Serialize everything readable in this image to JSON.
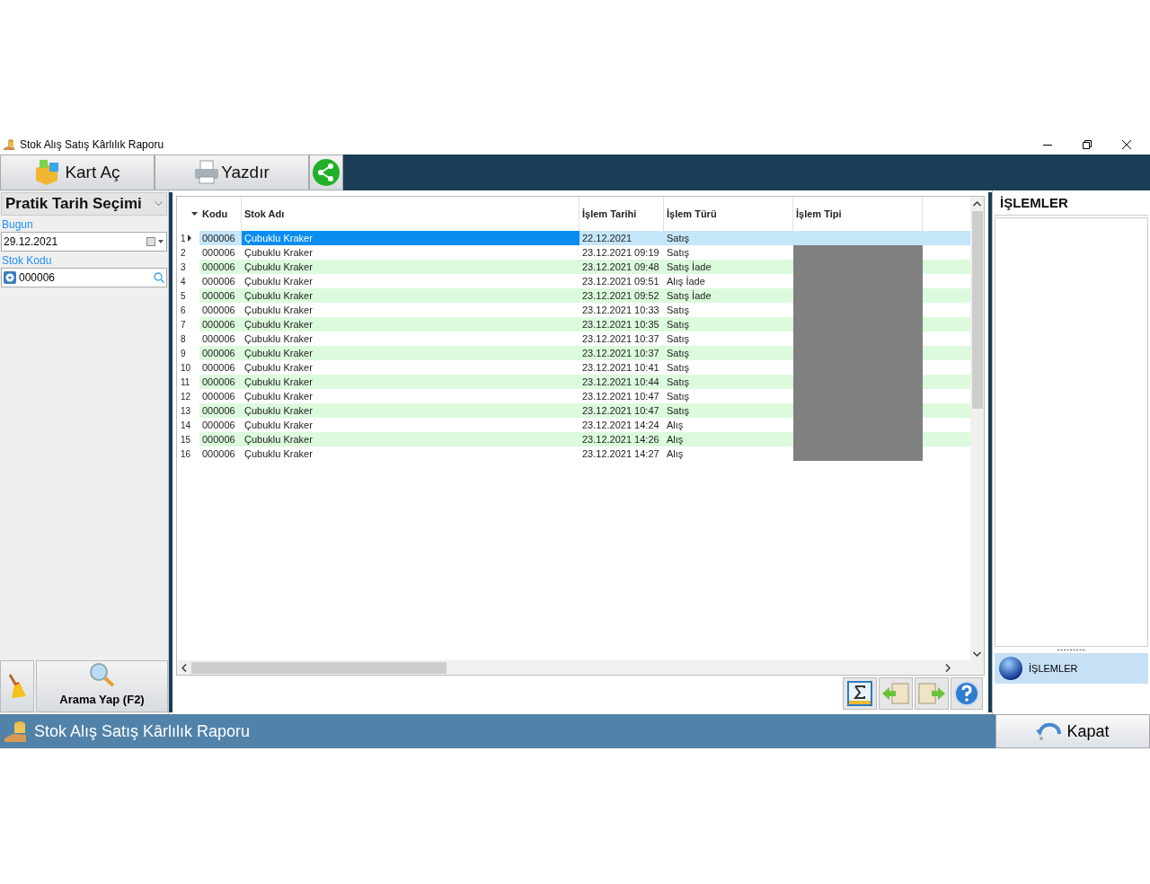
{
  "window": {
    "title": "Stok Alış Satış Kârlılık Raporu"
  },
  "toolbar": {
    "buttons": [
      {
        "label": "Kart Aç",
        "kind": "cube"
      },
      {
        "label": "Yazdır",
        "kind": "printer"
      },
      {
        "kind": "share"
      }
    ]
  },
  "filter_panel": {
    "dropdown": "Pratik Tarih Seçimi",
    "date_label": "Bugun",
    "date_value": "29.12.2021",
    "stock_label": "Stok Kodu",
    "stock_value": "000006",
    "search_button": "Arama Yap (F2)"
  },
  "table": {
    "columns": [
      "Kodu",
      "Stok Adı",
      "İşlem Tarihi",
      "İşlem Türü",
      "İşlem Tipi"
    ],
    "rows": [
      {
        "no": "1",
        "kodu": "000006",
        "stok_adi": "Çubuklu Kraker",
        "tarih": "22.12.2021",
        "tur": "Satış",
        "selected": true,
        "tipi_redacted": false
      },
      {
        "no": "2",
        "kodu": "000006",
        "stok_adi": "Çubuklu Kraker",
        "tarih": "23.12.2021 09:19",
        "tur": "Satış",
        "selected": false,
        "tipi_redacted": true
      },
      {
        "no": "3",
        "kodu": "000006",
        "stok_adi": "Çubuklu Kraker",
        "tarih": "23.12.2021 09:48",
        "tur": "Satış İade",
        "selected": false,
        "tipi_redacted": true
      },
      {
        "no": "4",
        "kodu": "000006",
        "stok_adi": "Çubuklu Kraker",
        "tarih": "23.12.2021 09:51",
        "tur": "Alış İade",
        "selected": false,
        "tipi_redacted": true
      },
      {
        "no": "5",
        "kodu": "000006",
        "stok_adi": "Çubuklu Kraker",
        "tarih": "23.12.2021 09:52",
        "tur": "Satış İade",
        "selected": false,
        "tipi_redacted": true
      },
      {
        "no": "6",
        "kodu": "000006",
        "stok_adi": "Çubuklu Kraker",
        "tarih": "23.12.2021 10:33",
        "tur": "Satış",
        "selected": false,
        "tipi_redacted": true
      },
      {
        "no": "7",
        "kodu": "000006",
        "stok_adi": "Çubuklu Kraker",
        "tarih": "23.12.2021 10:35",
        "tur": "Satış",
        "selected": false,
        "tipi_redacted": true
      },
      {
        "no": "8",
        "kodu": "000006",
        "stok_adi": "Çubuklu Kraker",
        "tarih": "23.12.2021 10:37",
        "tur": "Satış",
        "selected": false,
        "tipi_redacted": true
      },
      {
        "no": "9",
        "kodu": "000006",
        "stok_adi": "Çubuklu Kraker",
        "tarih": "23.12.2021 10:37",
        "tur": "Satış",
        "selected": false,
        "tipi_redacted": true
      },
      {
        "no": "10",
        "kodu": "000006",
        "stok_adi": "Çubuklu Kraker",
        "tarih": "23.12.2021 10:41",
        "tur": "Satış",
        "selected": false,
        "tipi_redacted": true
      },
      {
        "no": "11",
        "kodu": "000006",
        "stok_adi": "Çubuklu Kraker",
        "tarih": "23.12.2021 10:44",
        "tur": "Satış",
        "selected": false,
        "tipi_redacted": true
      },
      {
        "no": "12",
        "kodu": "000006",
        "stok_adi": "Çubuklu Kraker",
        "tarih": "23.12.2021 10:47",
        "tur": "Satış",
        "selected": false,
        "tipi_redacted": true
      },
      {
        "no": "13",
        "kodu": "000006",
        "stok_adi": "Çubuklu Kraker",
        "tarih": "23.12.2021 10:47",
        "tur": "Satış",
        "selected": false,
        "tipi_redacted": true
      },
      {
        "no": "14",
        "kodu": "000006",
        "stok_adi": "Çubuklu Kraker",
        "tarih": "23.12.2021 14:24",
        "tur": "Alış",
        "selected": false,
        "tipi_redacted": true
      },
      {
        "no": "15",
        "kodu": "000006",
        "stok_adi": "Çubuklu Kraker",
        "tarih": "23.12.2021 14:26",
        "tur": "Alış",
        "selected": false,
        "tipi_redacted": true
      },
      {
        "no": "16",
        "kodu": "000006",
        "stok_adi": "Çubuklu Kraker",
        "tarih": "23.12.2021 14:27",
        "tur": "Alış",
        "selected": false,
        "tipi_redacted": true
      }
    ]
  },
  "actions_panel": {
    "title": "İŞLEMLER",
    "items": [
      {
        "label": "İŞLEMLER",
        "selected": true
      }
    ]
  },
  "status_bar": {
    "title": "Stok Alış Satış Kârlılık Raporu",
    "close_button": "Kapat"
  }
}
